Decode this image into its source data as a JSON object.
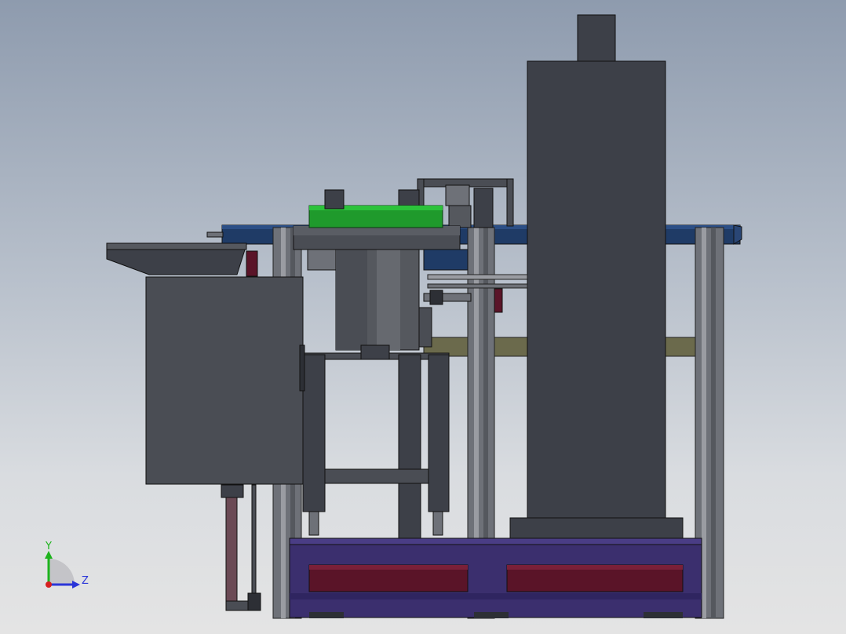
{
  "viewport": {
    "background_top": "#8e9bae",
    "background_bottom": "#e4e4e4"
  },
  "triad": {
    "y_label": "Y",
    "z_label": "Z",
    "y_color": "#1db31d",
    "z_color": "#2a35d8",
    "x_color": "#d62020"
  },
  "model": {
    "colors": {
      "dark_steel": "#3d4048",
      "panel_grey": "#4a4d54",
      "profile_grey": "#6e7178",
      "profile_light": "#9a9ca2",
      "base_purple": "#3b2f6e",
      "base_red": "#5a1428",
      "conveyor_blue": "#1f3b66",
      "bowl_green": "#1f9a2c",
      "rail_olive": "#6b6a4c"
    }
  }
}
